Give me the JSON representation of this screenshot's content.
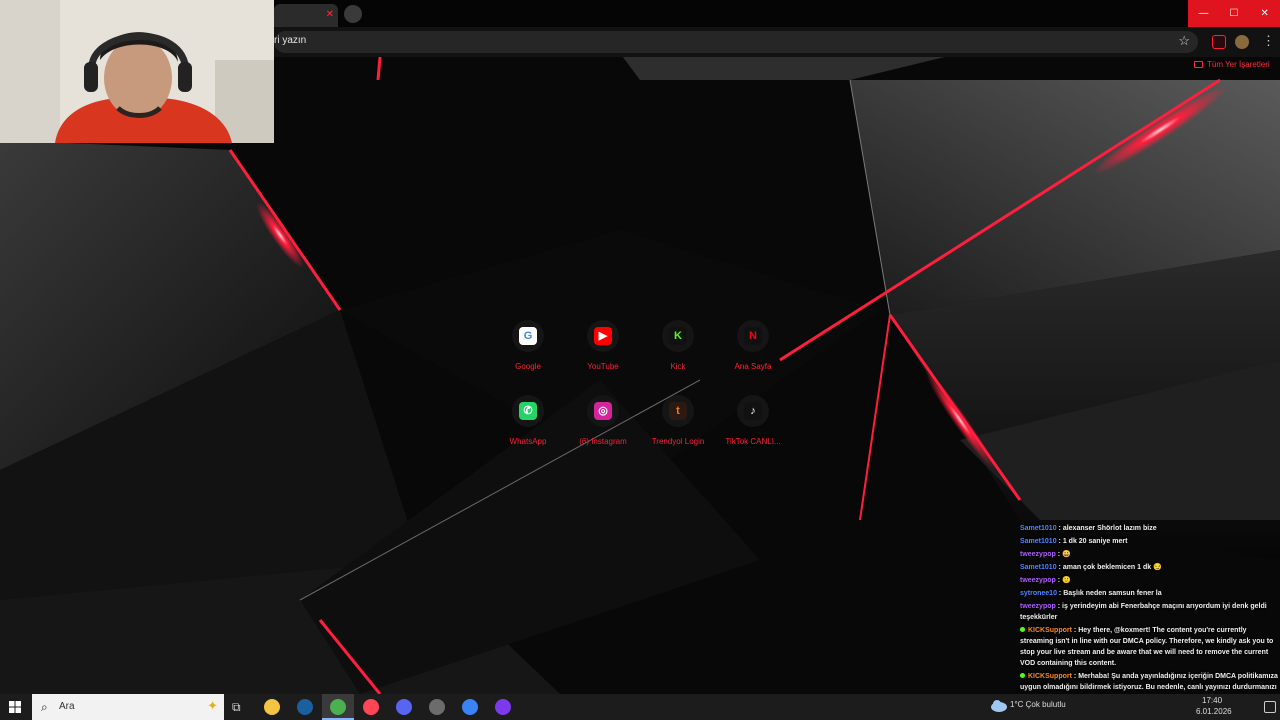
{
  "browser": {
    "tab_close_glyph": "✕",
    "window_controls": {
      "minimize": "—",
      "maximize": "☐",
      "close": "✕"
    },
    "omnibox_text": "ri yazın",
    "star_glyph": "☆",
    "menu_glyph": "⋮",
    "all_bookmarks": "Tüm Yer İşaretleri",
    "accent": "#ff1f36"
  },
  "shortcuts": [
    {
      "label": "Google",
      "glyph": "G",
      "icon": "google-icon",
      "color": "#4285f4",
      "bg": "#ffffff"
    },
    {
      "label": "YouTube",
      "glyph": "▶",
      "icon": "youtube-icon",
      "color": "#ffffff",
      "bg": "#ff0000"
    },
    {
      "label": "Kick",
      "glyph": "K",
      "icon": "kick-icon",
      "color": "#53fc18",
      "bg": "#111111"
    },
    {
      "label": "Ana Sayfa",
      "glyph": "N",
      "icon": "netflix-icon",
      "color": "#e50914",
      "bg": "#111111"
    },
    {
      "label": "WhatsApp",
      "glyph": "✆",
      "icon": "whatsapp-icon",
      "color": "#ffffff",
      "bg": "#25d366"
    },
    {
      "label": "(6) Instagram",
      "glyph": "◎",
      "icon": "instagram-icon",
      "color": "#ffffff",
      "bg": "#d6249f"
    },
    {
      "label": "Trendyol Login",
      "glyph": "t",
      "icon": "trendyol-icon",
      "color": "#f27a1a",
      "bg": "#2a1a12"
    },
    {
      "label": "TikTok CANLI...",
      "glyph": "♪",
      "icon": "tiktok-icon",
      "color": "#ffffff",
      "bg": "#111111"
    }
  ],
  "chat": [
    {
      "user": "Samet1010",
      "color": "#4f86ff",
      "text": "alexanser Shörlot lazım bize",
      "badge": false
    },
    {
      "user": "Samet1010",
      "color": "#4f86ff",
      "text": "1 dk 20 saniye mert",
      "badge": false
    },
    {
      "user": "tweezypop",
      "color": "#b05cff",
      "text": "😀",
      "badge": false
    },
    {
      "user": "Samet1010",
      "color": "#4f86ff",
      "text": "aman çok beklemicen 1 dk 😏",
      "badge": false
    },
    {
      "user": "tweezypop",
      "color": "#b05cff",
      "text": "🙂",
      "badge": false
    },
    {
      "user": "sytronee10",
      "color": "#4f86ff",
      "text": "Başlık neden samsun fener la",
      "badge": false
    },
    {
      "user": "tweezypop",
      "color": "#b05cff",
      "text": "iş yerindeyim abi Fenerbahçe maçını arıyordum iyi denk geldi teşekkürler",
      "badge": false
    },
    {
      "user": "KICKSupport",
      "color": "#ff8a1e",
      "text": "Hey there, @koxmert! The content you're currently streaming isn't in line with our DMCA policy. Therefore, we kindly ask you to stop your live stream and be aware that we will need to remove the current VOD containing this content.",
      "badge": true
    },
    {
      "user": "KICKSupport",
      "color": "#ff8a1e",
      "text": "Merhaba! Şu anda yayınladığınız içeriğin DMCA politikamıza uygun olmadığını bildirmek istiyoruz. Bu nedenle, canlı yayınızı durdurmanızı rica ediyoruz ve bu içeriği içeren mevcut VOD'u kaldırmamız gerekeceğini bilmenizi istiyoruz.",
      "badge": true
    }
  ],
  "taskbar": {
    "search_placeholder": "Ara",
    "search_glyph": "⌕",
    "highlight_glyph": "✦",
    "taskview_glyph": "⧉",
    "apps": [
      {
        "name": "file-explorer-icon",
        "color": "#f4c542",
        "active": false
      },
      {
        "name": "steam-icon",
        "color": "#1b5f9e",
        "active": false
      },
      {
        "name": "chrome-icon",
        "color": "#4caf50",
        "active": true
      },
      {
        "name": "valorant-icon",
        "color": "#ff4655",
        "active": false
      },
      {
        "name": "discord-icon",
        "color": "#5865f2",
        "active": false
      },
      {
        "name": "obs-icon",
        "color": "#6c6c6c",
        "active": false
      },
      {
        "name": "app-icon",
        "color": "#3b82f6",
        "active": false
      },
      {
        "name": "app-icon-2",
        "color": "#7c3aed",
        "active": false
      }
    ],
    "temp": "1°C Çok bulutlu",
    "time": "17:40",
    "date": "6.01.2026"
  }
}
